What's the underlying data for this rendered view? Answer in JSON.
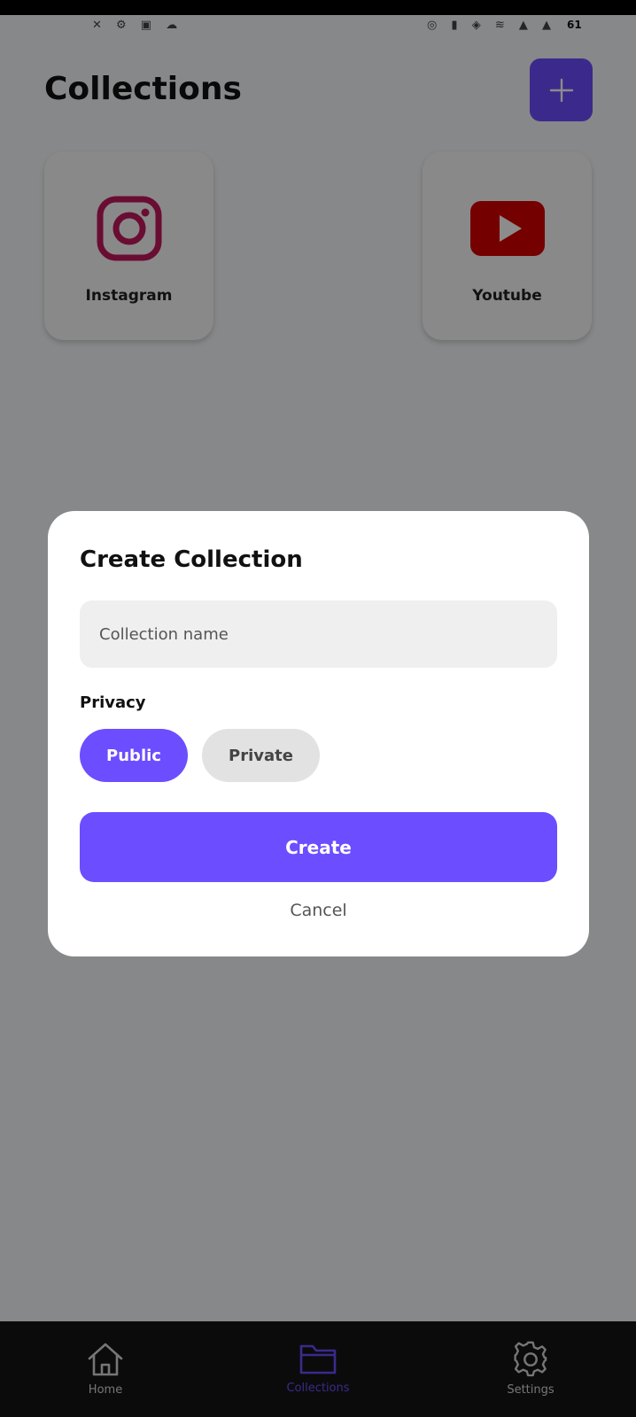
{
  "status_bar": {
    "time": "",
    "battery": "61"
  },
  "header": {
    "title": "Collections",
    "add_icon": "plus-icon"
  },
  "collections": [
    {
      "label": "Instagram",
      "icon": "instagram-icon",
      "color": "#c2185b"
    },
    {
      "label": "Youtube",
      "icon": "youtube-icon",
      "color": "#d50000"
    }
  ],
  "dialog": {
    "title": "Create Collection",
    "name_placeholder": "Collection name",
    "name_value": "",
    "privacy_label": "Privacy",
    "privacy_options": [
      "Public",
      "Private"
    ],
    "selected_privacy": "Public",
    "create_label": "Create",
    "cancel_label": "Cancel"
  },
  "bottom_nav": {
    "items": [
      {
        "label": "Home",
        "icon": "home-icon",
        "active": false
      },
      {
        "label": "Collections",
        "icon": "folder-icon",
        "active": true
      },
      {
        "label": "Settings",
        "icon": "gear-icon",
        "active": false
      }
    ]
  },
  "colors": {
    "accent": "#6c4dff",
    "nav_background": "#141414"
  }
}
